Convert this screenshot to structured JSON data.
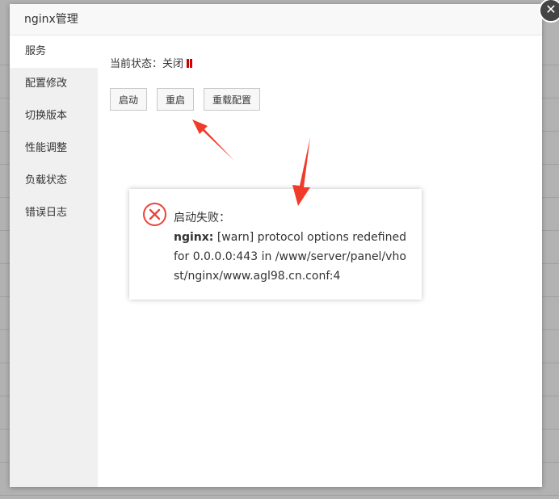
{
  "modal": {
    "title": "nginx管理",
    "close_icon": "close-icon"
  },
  "sidebar": {
    "items": [
      {
        "label": "服务",
        "active": true
      },
      {
        "label": "配置修改"
      },
      {
        "label": "切换版本"
      },
      {
        "label": "性能调整"
      },
      {
        "label": "负载状态"
      },
      {
        "label": "错误日志"
      }
    ]
  },
  "service": {
    "status_label": "当前状态：",
    "status_value": "关闭",
    "status_icon": "pause-icon",
    "status_color": "#cc0000",
    "buttons": {
      "start": "启动",
      "restart": "重启",
      "reload": "重载配置"
    }
  },
  "toast": {
    "icon": "error-icon",
    "icon_color": "#e8453c",
    "title": "启动失败：",
    "message_prefix": "nginx:",
    "message": " [warn] protocol options redefined for 0.0.0.0:443 in /www/server/panel/vhost/nginx/www.agl98.cn.conf:4"
  },
  "annotations": {
    "arrow_color": "#f03a2a"
  }
}
